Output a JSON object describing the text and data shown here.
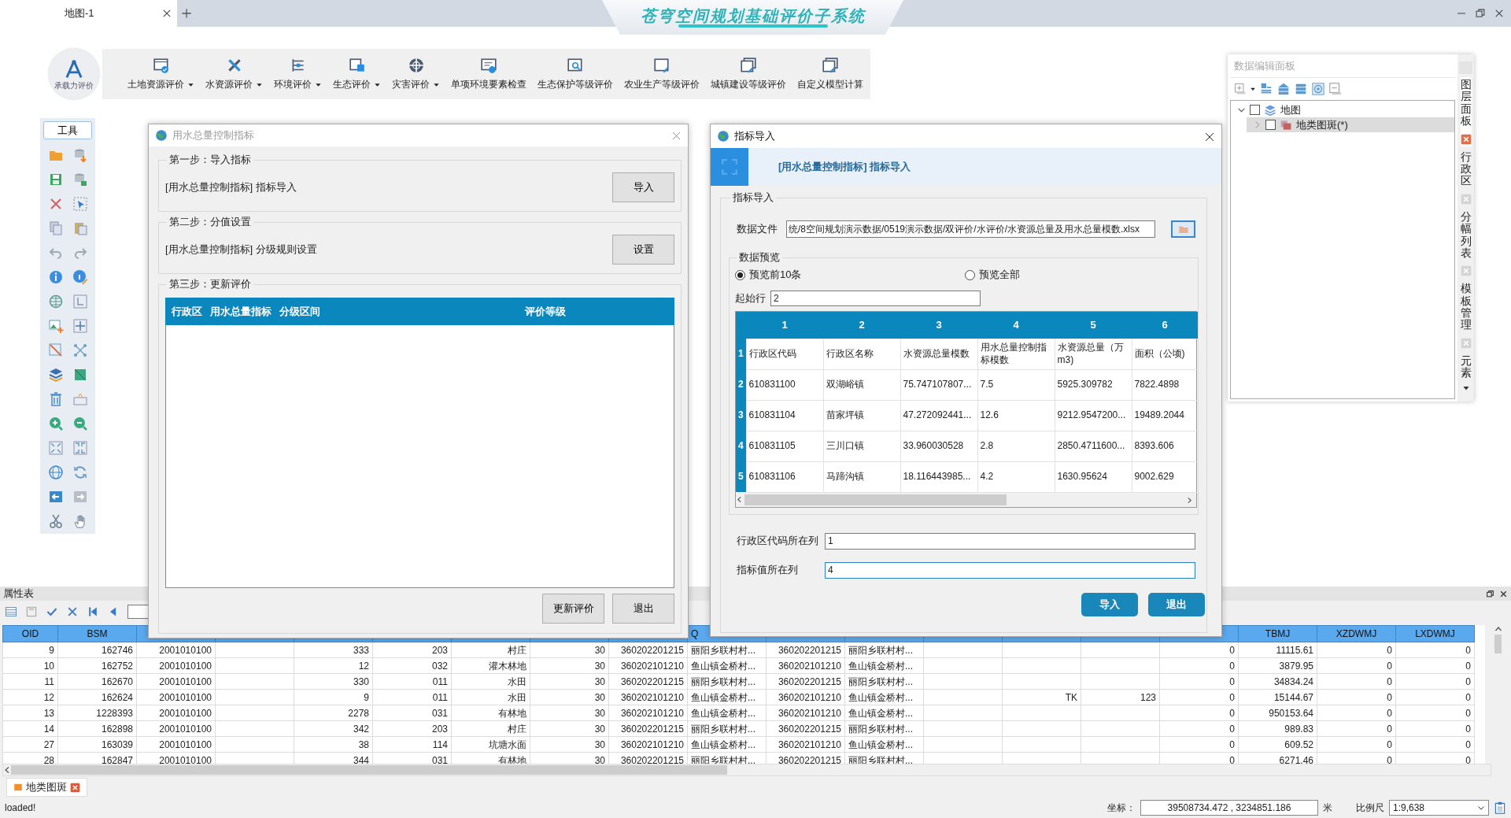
{
  "title_bar": {
    "tabs": [
      {
        "label": "地图-1",
        "selected": true
      }
    ],
    "app_title": "苍穹空间规划基础评价子系统"
  },
  "logo": {
    "caption": "承载力评价"
  },
  "ribbon": [
    {
      "label": "土地资源评价",
      "dropdown": true
    },
    {
      "label": "水资源评价",
      "dropdown": true
    },
    {
      "label": "环境评价",
      "dropdown": true
    },
    {
      "label": "生态评价",
      "dropdown": true
    },
    {
      "label": "灾害评价",
      "dropdown": true
    },
    {
      "label": "单项环境要素检查",
      "dropdown": false
    },
    {
      "label": "生态保护等级评价",
      "dropdown": false
    },
    {
      "label": "农业生产等级评价",
      "dropdown": false
    },
    {
      "label": "城镇建设等级评价",
      "dropdown": false
    },
    {
      "label": "自定义模型计算",
      "dropdown": false
    }
  ],
  "tools_panel": {
    "title": "工具"
  },
  "dialog_indicator": {
    "title": "用水总量控制指标",
    "active": false,
    "steps": [
      {
        "title": "第一步：导入指标",
        "text": "[用水总量控制指标] 指标导入",
        "button": "导入"
      },
      {
        "title": "第二步：分值设置",
        "text": "[用水总量控制指标] 分级规则设置",
        "button": "设置"
      }
    ],
    "update": {
      "title": "第三步：更新评价",
      "columns": [
        "行政区",
        "用水总量指标",
        "分级区间",
        "评价等级"
      ]
    },
    "buttons": [
      "更新评价",
      "退出"
    ]
  },
  "dialog_import": {
    "title": "指标导入",
    "active": true,
    "banner": "[用水总量控制指标] 指标导入",
    "group": "指标导入",
    "file": {
      "label": "数据文件",
      "value": "统/8空间规划演示数据/0519演示数据/双评价/水评价/水资源总量及用水总量模数.xlsx"
    },
    "preview": {
      "title": "数据预览",
      "options": [
        {
          "label": "预览前10条",
          "selected": true
        },
        {
          "label": "预览全部",
          "selected": false
        }
      ],
      "start": {
        "label": "起始行",
        "value": "2"
      },
      "columns": [
        "1",
        "2",
        "3",
        "4",
        "5",
        "6"
      ],
      "rows": [
        {
          "header": "1",
          "cells": [
            "行政区代码",
            "行政区名称",
            "水资源总量模数",
            "用水总量控制指标模数",
            "水资源总量（万m3)",
            "面积（公顷)"
          ]
        },
        {
          "header": "2",
          "cells": [
            "610831100",
            "双湖峪镇",
            "75.747107807...",
            "7.5",
            "5925.309782",
            "7822.4898"
          ]
        },
        {
          "header": "3",
          "cells": [
            "610831104",
            "苗家坪镇",
            "47.272092441...",
            "12.6",
            "9212.9547200...",
            "19489.2044"
          ]
        },
        {
          "header": "4",
          "cells": [
            "610831105",
            "三川口镇",
            "33.960030528",
            "2.8",
            "2850.4711600...",
            "8393.606"
          ]
        },
        {
          "header": "5",
          "cells": [
            "610831106",
            "马蹄沟镇",
            "18.116443985...",
            "4.2",
            "1630.95624",
            "9002.629"
          ]
        }
      ]
    },
    "fields": [
      {
        "label": "行政区代码所在列",
        "value": "1",
        "focused": false
      },
      {
        "label": "指标值所在列",
        "value": "4",
        "focused": true
      }
    ],
    "buttons": [
      "导入",
      "退出"
    ]
  },
  "layer_panel": {
    "title": "数据编辑面板",
    "tree": [
      {
        "label": "地图",
        "checked": false,
        "expanded": true,
        "selected": false,
        "children": [
          {
            "label": "地类图斑(*)",
            "checked": false,
            "expanded": false,
            "selected": true
          }
        ]
      }
    ],
    "side_tabs": [
      {
        "label": "图层面板",
        "selected": true
      },
      {
        "label": "行政区",
        "selected": false
      },
      {
        "label": "分幅列表",
        "selected": false
      },
      {
        "label": "模板管理",
        "selected": false
      },
      {
        "label": "元素",
        "selected": false
      }
    ]
  },
  "attribute_table": {
    "title": "属性表",
    "columns": [
      {
        "label": "OID",
        "kind": "number"
      },
      {
        "label": "BSM",
        "kind": "number"
      },
      {
        "kind": "number"
      },
      {
        "kind": "number"
      },
      {
        "kind": "number"
      },
      {
        "kind": "number"
      },
      {
        "kind": "number"
      },
      {
        "kind": "number"
      },
      {
        "kind": "number"
      },
      {
        "label": "Q",
        "kind": "name"
      },
      {
        "kind": "number"
      },
      {
        "kind": "name"
      },
      {
        "kind": "number"
      },
      {
        "kind": "number"
      },
      {
        "kind": "number"
      },
      {
        "kind": "number"
      },
      {
        "label": "TBMJ",
        "kind": "number"
      },
      {
        "label": "XZDWMJ",
        "kind": "number"
      },
      {
        "label": "LXDWMJ",
        "kind": "number"
      }
    ],
    "rows": [
      [
        "9",
        "162746",
        "2001010100",
        null,
        "333",
        "203",
        "村庄",
        "30",
        "360202201215",
        "丽阳乡联村村...",
        "360202201215",
        "丽阳乡联村村...",
        null,
        null,
        null,
        "0",
        "11115.61",
        "0",
        "0"
      ],
      [
        "10",
        "162752",
        "2001010100",
        null,
        "12",
        "032",
        "灌木林地",
        "30",
        "360202101210",
        "鱼山镇金桥村...",
        "360202101210",
        "鱼山镇金桥村...",
        null,
        null,
        null,
        "0",
        "3879.95",
        "0",
        "0"
      ],
      [
        "11",
        "162670",
        "2001010100",
        null,
        "330",
        "011",
        "水田",
        "30",
        "360202201215",
        "丽阳乡联村村...",
        "360202201215",
        "丽阳乡联村村...",
        null,
        null,
        null,
        "0",
        "34834.24",
        "0",
        "0"
      ],
      [
        "12",
        "162624",
        "2001010100",
        null,
        "9",
        "011",
        "水田",
        "30",
        "360202101210",
        "鱼山镇金桥村...",
        "360202101210",
        "鱼山镇金桥村...",
        null,
        "TK",
        "123",
        "0",
        "15144.67",
        "0",
        "0"
      ],
      [
        "13",
        "1228393",
        "2001010100",
        null,
        "2278",
        "031",
        "有林地",
        "30",
        "360202101210",
        "鱼山镇金桥村...",
        "360202101210",
        "鱼山镇金桥村...",
        null,
        null,
        null,
        "0",
        "950153.64",
        "0",
        "0"
      ],
      [
        "14",
        "162898",
        "2001010100",
        null,
        "342",
        "203",
        "村庄",
        "30",
        "360202201215",
        "丽阳乡联村村...",
        "360202201215",
        "丽阳乡联村村...",
        null,
        null,
        null,
        "0",
        "989.83",
        "0",
        "0"
      ],
      [
        "27",
        "163039",
        "2001010100",
        null,
        "38",
        "114",
        "坑塘水面",
        "30",
        "360202101210",
        "鱼山镇金桥村...",
        "360202101210",
        "鱼山镇金桥村...",
        null,
        null,
        null,
        "0",
        "609.52",
        "0",
        "0"
      ],
      [
        "28",
        "162847",
        "2001010100",
        null,
        "344",
        "031",
        "有林地",
        "30",
        "360202201215",
        "丽阳乡联村村...",
        "360202201215",
        "丽阳乡联村村...",
        null,
        null,
        null,
        "0",
        "6271.46",
        "0",
        "0"
      ]
    ]
  },
  "layer_tabs": [
    {
      "label": "地类图斑"
    }
  ],
  "status_bar": {
    "message": "loaded!",
    "coord_label": "坐标：",
    "coord_value": "39508734.472 , 3234851.186",
    "unit": "米",
    "scale_label": "比例尺",
    "scale_value": "1:9,638"
  }
}
